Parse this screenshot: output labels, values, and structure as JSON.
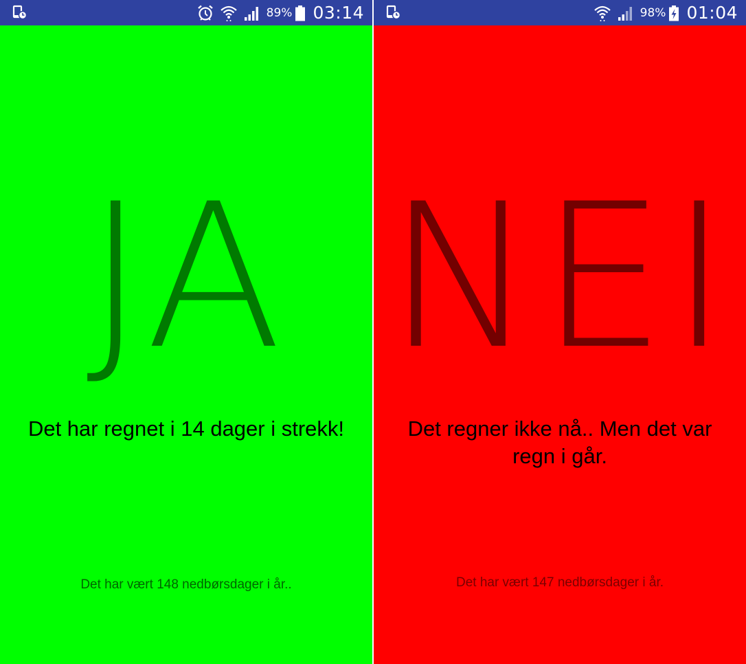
{
  "screens": [
    {
      "background": "#00ff00",
      "answer_color": "#007a00",
      "footer_color": "#006600",
      "statusbar": {
        "battery": "89%",
        "time": "03:14",
        "icons": [
          "notification-timer-icon",
          "alarm-icon",
          "wifi-icon",
          "signal-icon",
          "battery-icon"
        ]
      },
      "answer": "JA",
      "message": "Det har regnet i 14 dager i strekk!",
      "footer": "Det har vært 148 nedbørsdager i år.."
    },
    {
      "background": "#ff0000",
      "answer_color": "#730000",
      "footer_color": "#7a0000",
      "statusbar": {
        "battery": "98%",
        "time": "01:04",
        "icons": [
          "notification-timer-icon",
          "wifi-icon",
          "signal-icon",
          "battery-charging-icon"
        ]
      },
      "answer": "NEI",
      "message": "Det regner ikke nå.. Men det var regn i går.",
      "footer": "Det har vært 147 nedbørsdager i år."
    }
  ]
}
